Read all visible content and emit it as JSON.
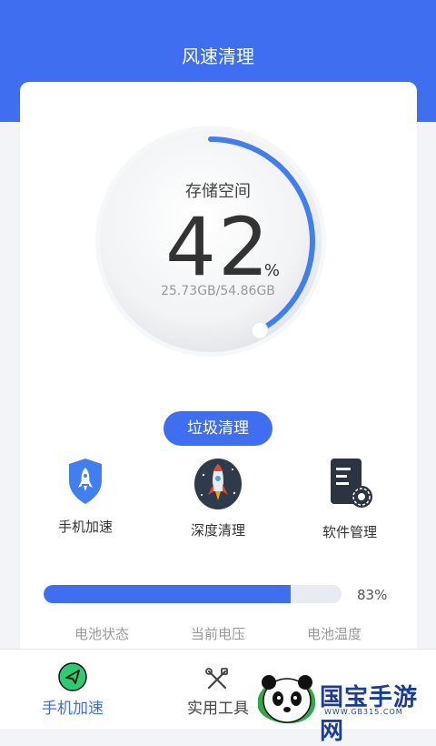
{
  "header": {
    "title": "风速清理"
  },
  "storage": {
    "label": "存储空间",
    "percent": "42",
    "percent_sign": "%",
    "usage": "25.73GB/54.86GB",
    "fraction": 0.42
  },
  "clean_button": {
    "label": "垃圾清理"
  },
  "features": [
    {
      "label": "手机加速",
      "icon": "rocket-shield-icon"
    },
    {
      "label": "深度清理",
      "icon": "rocket-badge-icon"
    },
    {
      "label": "软件管理",
      "icon": "document-gear-icon"
    }
  ],
  "battery": {
    "percent_label": "83%",
    "fraction": 0.83
  },
  "stats": [
    {
      "label": "电池状态",
      "value": ""
    },
    {
      "label": "当前电压",
      "value": ""
    },
    {
      "label": "电池温度",
      "value": ""
    }
  ],
  "tabs": [
    {
      "label": "手机加速",
      "icon": "paper-plane-icon",
      "active": true
    },
    {
      "label": "实用工具",
      "icon": "tools-icon",
      "active": false
    }
  ],
  "watermark": {
    "text": "国宝手游网",
    "url": "WWW.GB315.COM"
  },
  "colors": {
    "primary": "#3f6ff0",
    "background": "#f2f4f8"
  }
}
